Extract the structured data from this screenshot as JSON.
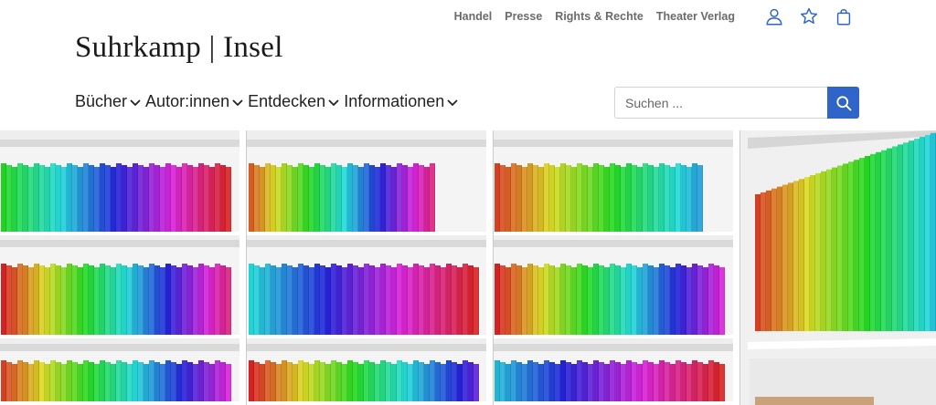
{
  "header": {
    "logo_text": "Suhrkamp | Insel",
    "top_links": [
      {
        "label": "Handel"
      },
      {
        "label": "Presse"
      },
      {
        "label": "Rights & Rechte"
      },
      {
        "label": "Theater Verlag"
      }
    ],
    "icons": [
      "user-icon",
      "star-icon",
      "shopping-bag-icon"
    ],
    "accent_color": "#2f64c8"
  },
  "main_nav": [
    {
      "label": "Bücher"
    },
    {
      "label": "Autor:innen"
    },
    {
      "label": "Entdecken"
    },
    {
      "label": "Informationen"
    }
  ],
  "search": {
    "placeholder": "Suchen ...",
    "value": ""
  },
  "hero": {
    "description_icon": "bookshelf-image"
  }
}
